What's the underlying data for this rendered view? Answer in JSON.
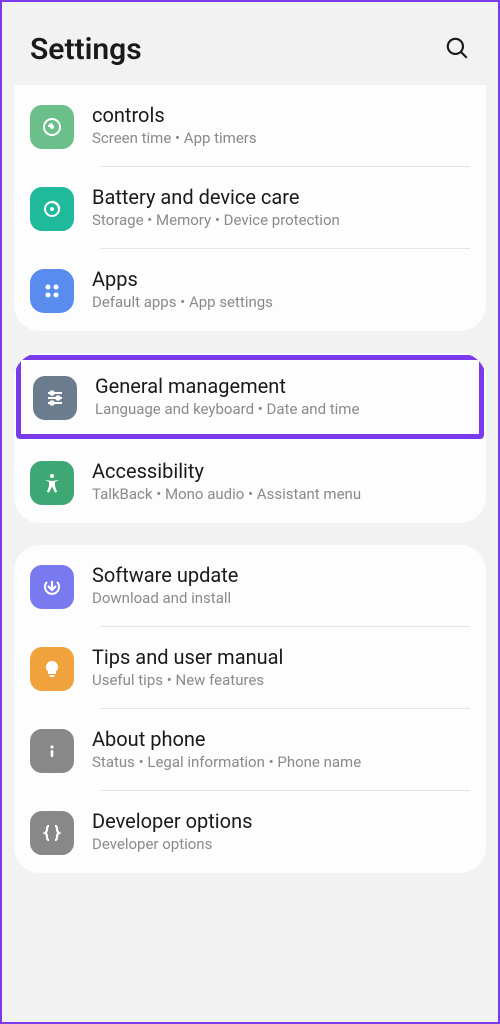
{
  "header": {
    "title": "Settings"
  },
  "groups": [
    {
      "items": [
        {
          "title": "controls",
          "subtitle": "Screen time  •  App timers"
        },
        {
          "title": "Battery and device care",
          "subtitle": "Storage  •  Memory  •  Device protection"
        },
        {
          "title": "Apps",
          "subtitle": "Default apps  •  App settings"
        }
      ]
    },
    {
      "items": [
        {
          "title": "General management",
          "subtitle": "Language and keyboard  •  Date and time"
        },
        {
          "title": "Accessibility",
          "subtitle": "TalkBack  •  Mono audio  •  Assistant menu"
        }
      ]
    },
    {
      "items": [
        {
          "title": "Software update",
          "subtitle": "Download and install"
        },
        {
          "title": "Tips and user manual",
          "subtitle": "Useful tips  •  New features"
        },
        {
          "title": "About phone",
          "subtitle": "Status  •  Legal information  •  Phone name"
        },
        {
          "title": "Developer options",
          "subtitle": "Developer options"
        }
      ]
    }
  ]
}
